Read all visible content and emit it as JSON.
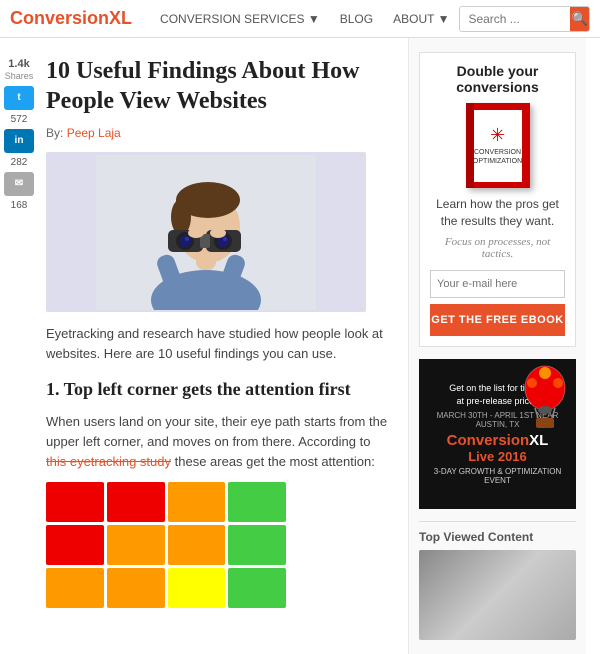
{
  "nav": {
    "logo_text": "Conversion",
    "logo_accent": "XL",
    "links": [
      {
        "label": "CONVERSION SERVICES ▼",
        "id": "conversion-services"
      },
      {
        "label": "BLOG",
        "id": "blog"
      },
      {
        "label": "ABOUT ▼",
        "id": "about"
      }
    ],
    "search_placeholder": "Search ..."
  },
  "social": {
    "total_count": "1.4k",
    "total_label": "Shares",
    "twitter_count": "572",
    "linkedin_count": "282",
    "email_count": "168"
  },
  "article": {
    "title": "10 Useful Findings About How People View Websites",
    "author_label": "By:",
    "author_name": "Peep Laja",
    "intro": "Eyetracking and research have studied how people look at websites. Here are 10 useful findings you can use.",
    "section1_heading": "1. Top left corner gets the attention first",
    "section1_text": "When users land on your site, their eye path starts from the upper left corner, and moves on from there. According to this eyetracking study these areas get the most attention:"
  },
  "heatmap": {
    "cells": [
      "#e00",
      "#e00",
      "#f90",
      "#4c4",
      "#e00",
      "#f90",
      "#f90",
      "#4c4",
      "#f90",
      "#f90",
      "#ff0",
      "#4c4"
    ]
  },
  "sidebar": {
    "promo_title": "Double your conversions",
    "promo_body": "Learn how the pros get the results they want.",
    "promo_tagline": "Focus on processes, not tactics.",
    "email_placeholder": "Your e-mail here",
    "cta_label": "GET THE FREE EBOOK",
    "event_top_line1": "Get on the list for tickets",
    "event_top_line2": "at pre-release prices",
    "event_date": "MARCH 30TH - APRIL 1ST  NEAR AUSTIN, TX",
    "event_brand_line1": "ConversionXL",
    "event_brand_line2": "Live 2016",
    "event_sub": "3-DAY GROWTH & OPTIMIZATION EVENT",
    "viewed_title": "Top Viewed Content"
  }
}
